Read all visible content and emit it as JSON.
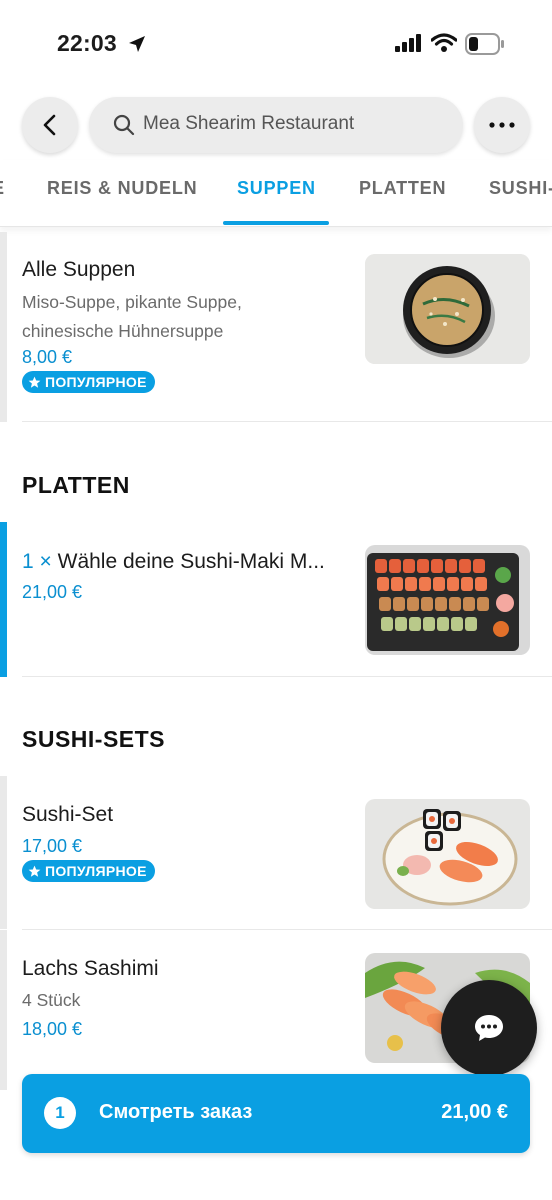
{
  "status_bar": {
    "time": "22:03"
  },
  "header": {
    "search_text": "Mea Shearim Restaurant"
  },
  "tabs": [
    {
      "label": "E"
    },
    {
      "label": "REIS & NUDELN"
    },
    {
      "label": "SUPPEN"
    },
    {
      "label": "PLATTEN"
    },
    {
      "label": "SUSHI-"
    }
  ],
  "items": {
    "soup": {
      "title": "Alle Suppen",
      "desc": "Miso-Suppe, pikante Suppe, chinesische Hühnersuppe",
      "price": "8,00 €",
      "badge": "ПОПУЛЯРНОЕ"
    },
    "platter": {
      "qty": "1 ×",
      "title": "Wähle deine Sushi-Maki M...",
      "price": "21,00 €"
    },
    "sushi_set": {
      "title": "Sushi-Set",
      "price": "17,00 €",
      "badge": "ПОПУЛЯРНОЕ"
    },
    "sashimi": {
      "title": "Lachs Sashimi",
      "desc": "4 Stück",
      "price": "18,00 €"
    }
  },
  "sections": {
    "platten": "PLATTEN",
    "sushi_sets": "SUSHI-SETS"
  },
  "order": {
    "count": "1",
    "label": "Смотреть заказ",
    "total": "21,00 €"
  },
  "colors": {
    "accent": "#0a9fe2",
    "price": "#0a8fd0"
  }
}
